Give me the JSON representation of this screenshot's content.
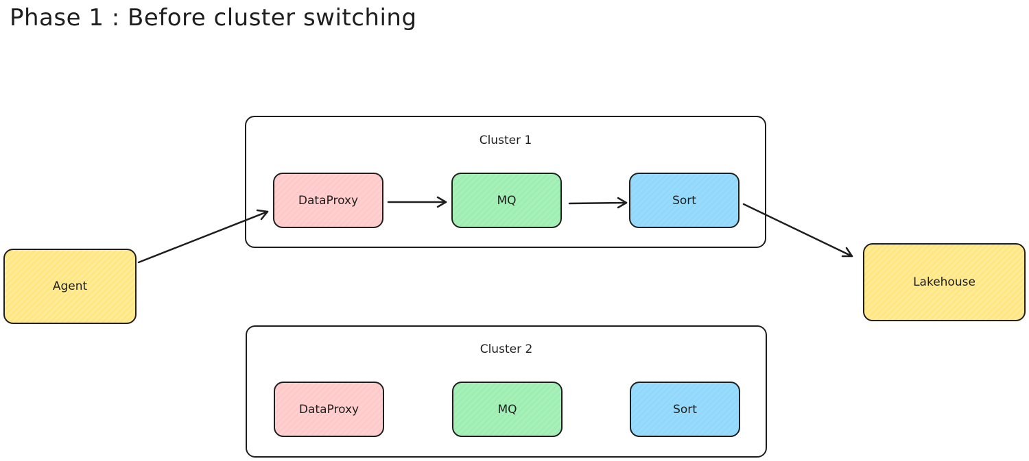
{
  "title": "Phase 1 : Before cluster switching",
  "nodes": {
    "agent": "Agent",
    "lakehouse": "Lakehouse"
  },
  "clusters": [
    {
      "label": "Cluster 1",
      "components": [
        "DataProxy",
        "MQ",
        "Sort"
      ]
    },
    {
      "label": "Cluster 2",
      "components": [
        "DataProxy",
        "MQ",
        "Sort"
      ]
    }
  ],
  "edges": [
    {
      "from": "Agent",
      "to": "Cluster 1 DataProxy"
    },
    {
      "from": "Cluster 1 DataProxy",
      "to": "Cluster 1 MQ"
    },
    {
      "from": "Cluster 1 MQ",
      "to": "Cluster 1 Sort"
    },
    {
      "from": "Cluster 1 Sort",
      "to": "Lakehouse"
    }
  ],
  "colors": {
    "dataproxy": "#ffc9c9",
    "mq": "#9eeeb2",
    "sort": "#92d8fb",
    "endpoint": "#ffe680",
    "stroke": "#1e1e1e"
  }
}
